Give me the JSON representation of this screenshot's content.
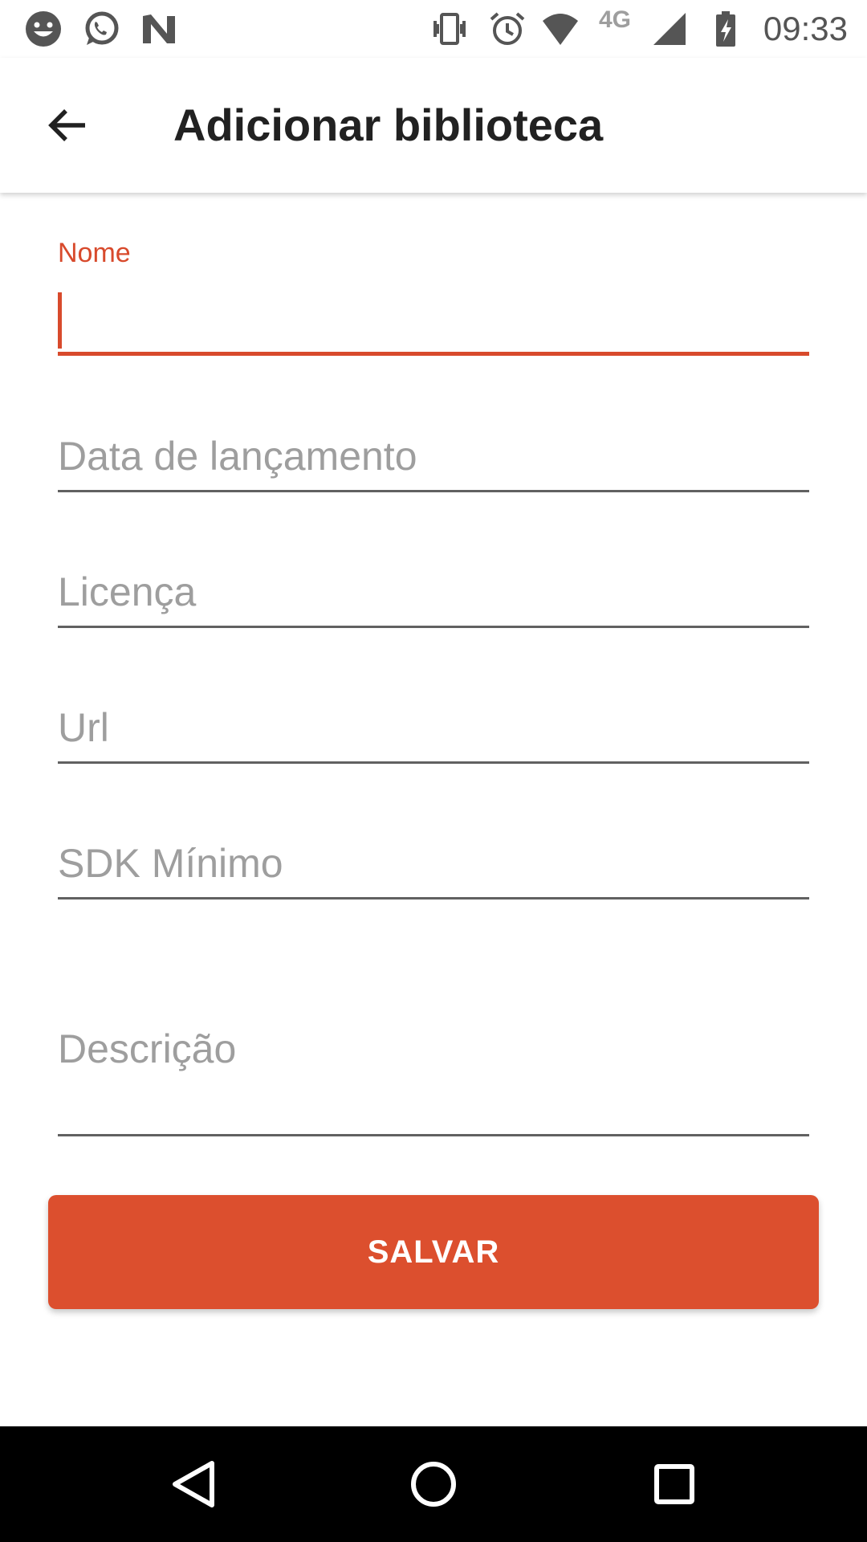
{
  "status_bar": {
    "time": "09:33",
    "network_label": "4G",
    "left_icons": [
      "smiley-notification-icon",
      "whatsapp-icon",
      "n-app-icon"
    ],
    "right_icons": [
      "vibrate-icon",
      "alarm-icon",
      "wifi-icon",
      "signal-icon",
      "battery-charging-icon"
    ]
  },
  "app_bar": {
    "title": "Adicionar biblioteca",
    "back_icon": "arrow-back-icon"
  },
  "form": {
    "nome": {
      "label": "Nome",
      "value": ""
    },
    "data_lancamento": {
      "placeholder": "Data de lançamento",
      "value": ""
    },
    "licenca": {
      "placeholder": "Licença",
      "value": ""
    },
    "url": {
      "placeholder": "Url",
      "value": ""
    },
    "sdk_minimo": {
      "placeholder": "SDK Mínimo",
      "value": ""
    },
    "descricao": {
      "placeholder": "Descrição",
      "value": ""
    }
  },
  "actions": {
    "save_label": "SALVAR"
  },
  "nav_bar": {
    "buttons": [
      "back-triangle-icon",
      "home-circle-icon",
      "recents-square-icon"
    ]
  },
  "colors": {
    "accent": "#dc4f2e",
    "label_active": "#d84a2c",
    "placeholder": "#9e9e9e",
    "title_text": "#212121"
  }
}
